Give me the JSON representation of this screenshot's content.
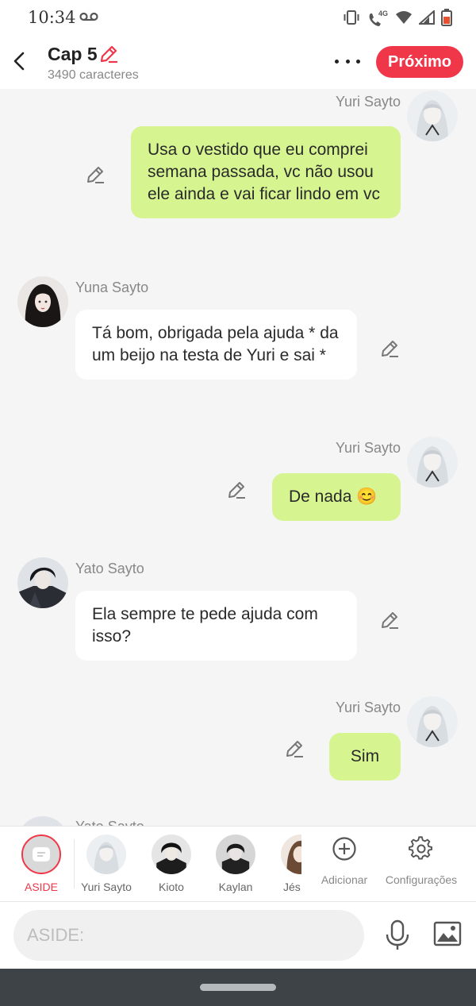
{
  "status": {
    "time": "10:34",
    "network": "4G"
  },
  "header": {
    "title": "Cap 5",
    "char_count": "3490 caracteres",
    "next_label": "Próximo"
  },
  "messages": [
    {
      "sender": "Yuri Sayto",
      "text": "Usa o vestido que eu comprei semana passada, vc não usou ele ainda e vai ficar lindo em vc",
      "side": "right"
    },
    {
      "sender": "Yuna Sayto",
      "text": "Tá bom, obrigada pela ajuda * da um beijo na testa de Yuri e sai *",
      "side": "left"
    },
    {
      "sender": "Yuri Sayto",
      "text": "De nada 😊",
      "side": "right"
    },
    {
      "sender": "Yato Sayto",
      "text": "Ela sempre te pede ajuda com isso?",
      "side": "left"
    },
    {
      "sender": "Yuri Sayto",
      "text": "Sim",
      "side": "right"
    },
    {
      "sender": "Yato Sayto",
      "text": "",
      "side": "left"
    }
  ],
  "characters": [
    {
      "name": "ASIDE"
    },
    {
      "name": "Yuri Sayto"
    },
    {
      "name": "Kioto"
    },
    {
      "name": "Kaylan"
    },
    {
      "name": "Jés"
    }
  ],
  "tools": {
    "add_label": "Adicionar",
    "settings_label": "Configurações"
  },
  "input": {
    "placeholder": "ASIDE:"
  },
  "colors": {
    "accent": "#f0374a",
    "my_bubble": "#d6f591",
    "other_bubble": "#ffffff",
    "background": "#f5f5f5"
  },
  "icons": [
    "voicemail-icon",
    "vibrate-icon",
    "wifi-calling-icon",
    "wifi-icon",
    "signal-icon",
    "battery-icon",
    "back-arrow-icon",
    "pencil-icon",
    "more-icon",
    "add-icon",
    "gear-icon",
    "mic-icon",
    "image-icon"
  ]
}
